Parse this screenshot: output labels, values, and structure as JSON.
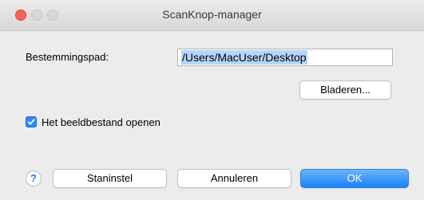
{
  "window": {
    "title": "ScanKnop-manager"
  },
  "destination": {
    "label": "Bestemmingspad:",
    "value": "/Users/MacUser/Desktop"
  },
  "browse_label": "Bladeren...",
  "open_checkbox": {
    "label": "Het beeldbestand openen",
    "checked": true
  },
  "help_glyph": "?",
  "buttons": {
    "default": "Staninstel",
    "cancel": "Annuleren",
    "ok": "OK"
  },
  "colors": {
    "accent": "#1a82fb",
    "selection": "#b5d5ff"
  }
}
